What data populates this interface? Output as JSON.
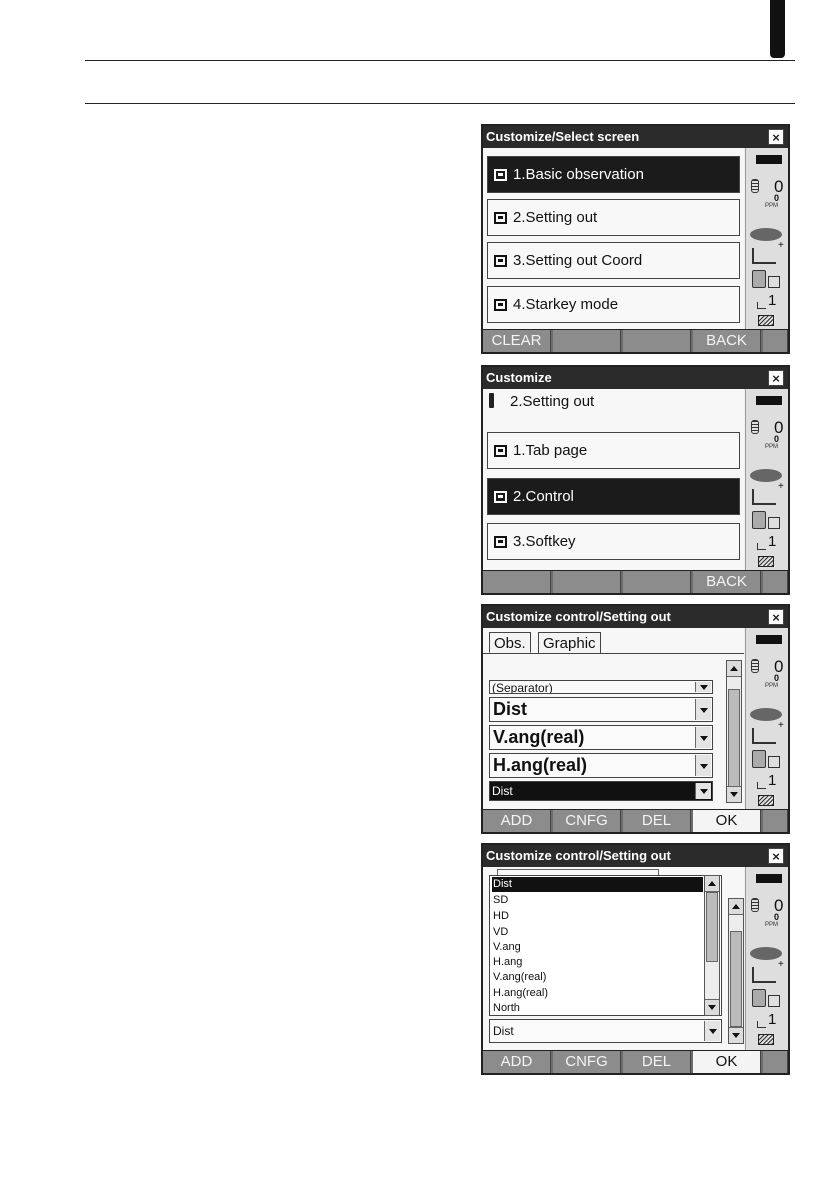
{
  "screen1": {
    "title": "Customize/Select screen",
    "close": "×",
    "items": [
      "1.Basic observation",
      "2.Setting out",
      "3.Setting out Coord",
      "4.Starkey mode"
    ],
    "softkeys": [
      "CLEAR",
      "",
      "",
      "BACK",
      ""
    ]
  },
  "screen2": {
    "title": "Customize",
    "close": "×",
    "subheading": "2.Setting out",
    "items": [
      "1.Tab page",
      "2.Control",
      "3.Softkey"
    ],
    "softkeys": [
      "",
      "",
      "",
      "BACK",
      ""
    ]
  },
  "screen3": {
    "title": "Customize control/Setting out",
    "close": "×",
    "tabs": [
      "Obs.",
      "Graphic"
    ],
    "dropdowns": [
      "(Separator)",
      "Dist",
      "V.ang(real)",
      "H.ang(real)",
      "Dist"
    ],
    "softkeys": [
      "ADD",
      "CNFG",
      "DEL",
      "OK",
      ""
    ]
  },
  "screen4": {
    "title": "Customize control/Setting out",
    "close": "×",
    "options": [
      "Dist",
      "SD",
      "HD",
      "VD",
      "V.ang",
      "H.ang",
      "V.ang(real)",
      "H.ang(real)",
      "North"
    ],
    "selected_value": "Dist",
    "softkeys": [
      "ADD",
      "CNFG",
      "DEL",
      "OK",
      ""
    ]
  },
  "status": {
    "value": "0",
    "small_value": "0",
    "ppm": "PPM",
    "number": "1"
  }
}
